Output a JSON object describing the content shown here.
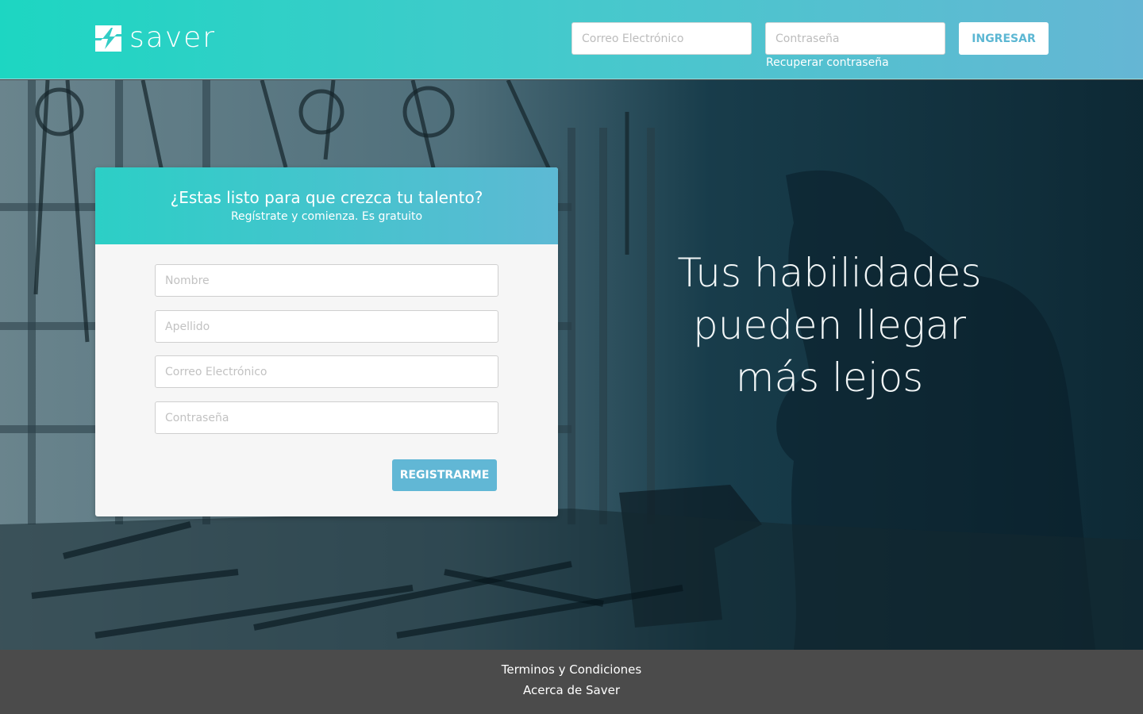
{
  "header": {
    "brand": "saver",
    "email_placeholder": "Correo Electrónico",
    "password_placeholder": "Contraseña",
    "login_label": "INGRESAR",
    "recover_label": "Recuperar contraseña"
  },
  "hero": {
    "tagline_lines": [
      "Tus habilidades",
      "pueden llegar",
      "más lejos"
    ]
  },
  "signup": {
    "title": "¿Estas listo para que crezca tu talento?",
    "subtitle": "Regístrate  y comienza. Es gratuito",
    "name_placeholder": "Nombre",
    "lastname_placeholder": "Apellido",
    "email_placeholder": "Correo Electrónico",
    "password_placeholder": "Contraseña",
    "submit_label": "REGISTRARME"
  },
  "footer": {
    "terms_label": "Terminos y Condiciones",
    "about_label": "Acerca de Saver"
  },
  "colors": {
    "header_gradient_start": "#1dd6c2",
    "header_gradient_end": "#65b6d4",
    "accent_button": "#61b7d5",
    "footer_bg": "#4b4b4b"
  },
  "icons": {
    "logo": "saver-logo-icon"
  }
}
